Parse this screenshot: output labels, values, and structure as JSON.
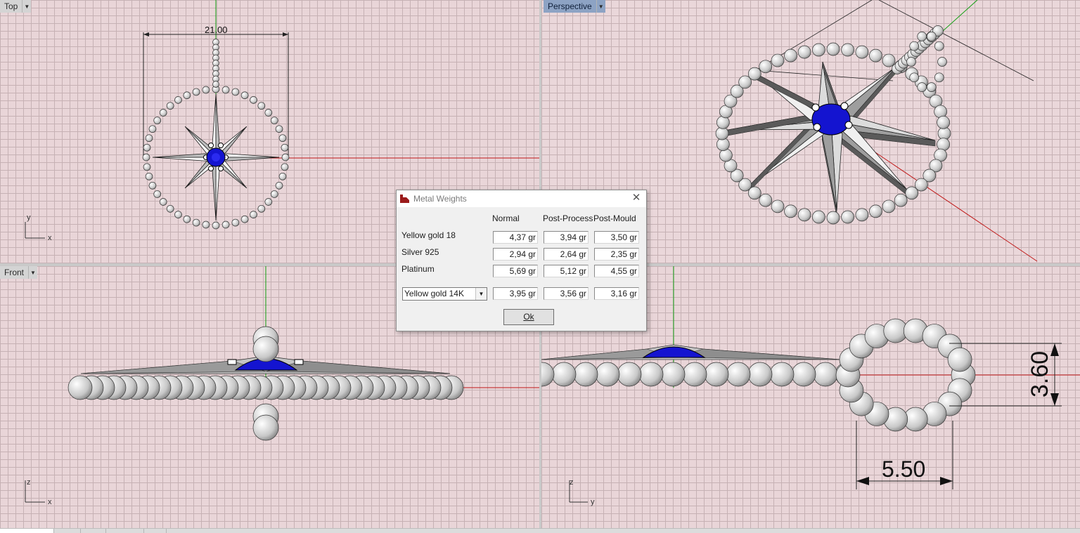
{
  "viewports": {
    "top": {
      "label": "Top",
      "dimension": "21.00",
      "axes": {
        "v": "y",
        "h": "x"
      }
    },
    "perspective": {
      "label": "Perspective"
    },
    "front": {
      "label": "Front",
      "axes": {
        "v": "z",
        "h": "x"
      }
    },
    "right": {
      "dim_height": "3.60",
      "dim_width": "5.50",
      "axes": {
        "v": "z",
        "h": "y"
      }
    }
  },
  "dialog": {
    "title": "Metal Weights",
    "columns": [
      "Normal",
      "Post-Process",
      "Post-Mould"
    ],
    "rows": [
      {
        "metal": "Yellow gold 18",
        "values": [
          "4,37 gr",
          "3,94 gr",
          "3,50 gr"
        ]
      },
      {
        "metal": "Silver 925",
        "values": [
          "2,94 gr",
          "2,64 gr",
          "2,35 gr"
        ]
      },
      {
        "metal": "Platinum",
        "values": [
          "5,69 gr",
          "5,12 gr",
          "4,55 gr"
        ]
      }
    ],
    "selected_metal": "Yellow gold 14K",
    "selected_values": [
      "3,95 gr",
      "3,56 gr",
      "3,16 gr"
    ],
    "ok_label": "Ok"
  },
  "colors": {
    "grid": "#c6b1b4",
    "viewport_bg": "#e9d5d8",
    "x_axis": "#c01818",
    "y_axis": "#12a012",
    "stone": "#1010d8",
    "active_label": "#8da3c4"
  }
}
